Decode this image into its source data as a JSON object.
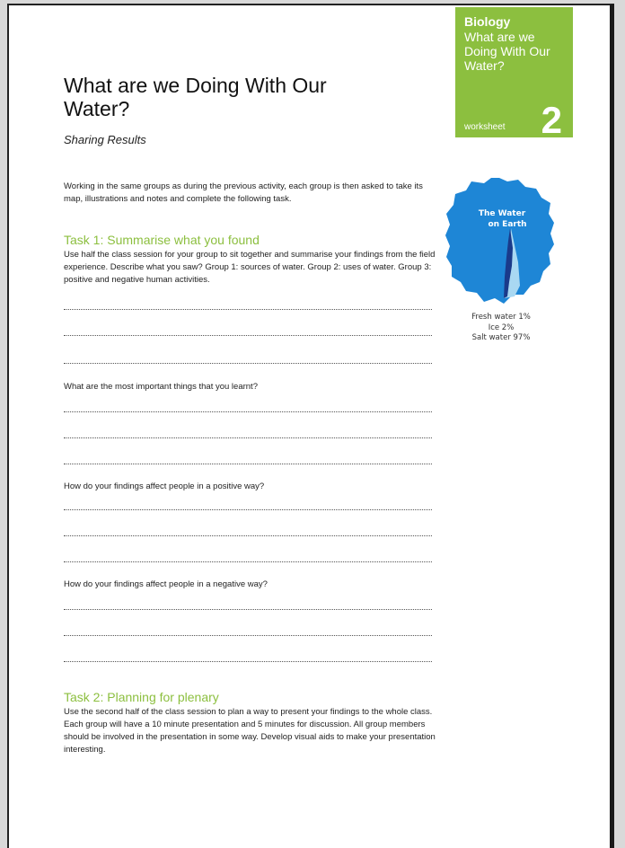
{
  "badge": {
    "subject": "Biology",
    "title": "What are we Doing With Our Water?",
    "worksheet_label": "worksheet",
    "number": "2",
    "color": "#8cbf3f"
  },
  "header": {
    "title": "What are we Doing With Our Water?",
    "subtitle": "Sharing Results"
  },
  "intro": "Working in the same groups as during the previous activity, each group is then asked to take its map, illustrations and notes and complete the following task.",
  "task1": {
    "heading": "Task 1: Summarise what you found",
    "text": "Use half the class session for your group to sit together and summarise your findings from the field experience. Describe what you saw? Group 1: sources of water. Group 2: uses of water. Group 3: positive and negative human activities."
  },
  "questions": [
    "What are the most important things that you learnt?",
    "How do your findings affect people in a positive way?",
    "How do your findings affect people in a negative way?"
  ],
  "task2": {
    "heading": "Task 2: Planning for plenary",
    "text": "Use the second half of the class session to plan a way to present your findings to the whole class. Each group will have a 10 minute presentation and 5 minutes for discussion. All group members should be involved in the presentation in some way. Develop visual aids to make your presentation interesting."
  },
  "globe": {
    "label_line1": "The Water",
    "label_line2": "on Earth",
    "caption": [
      "Fresh water 1%",
      "Ice 2%",
      "Salt water 97%"
    ],
    "salt_color": "#1e86d6",
    "ice_color": "#a9d8f2",
    "fresh_color": "#1a3a8a"
  }
}
